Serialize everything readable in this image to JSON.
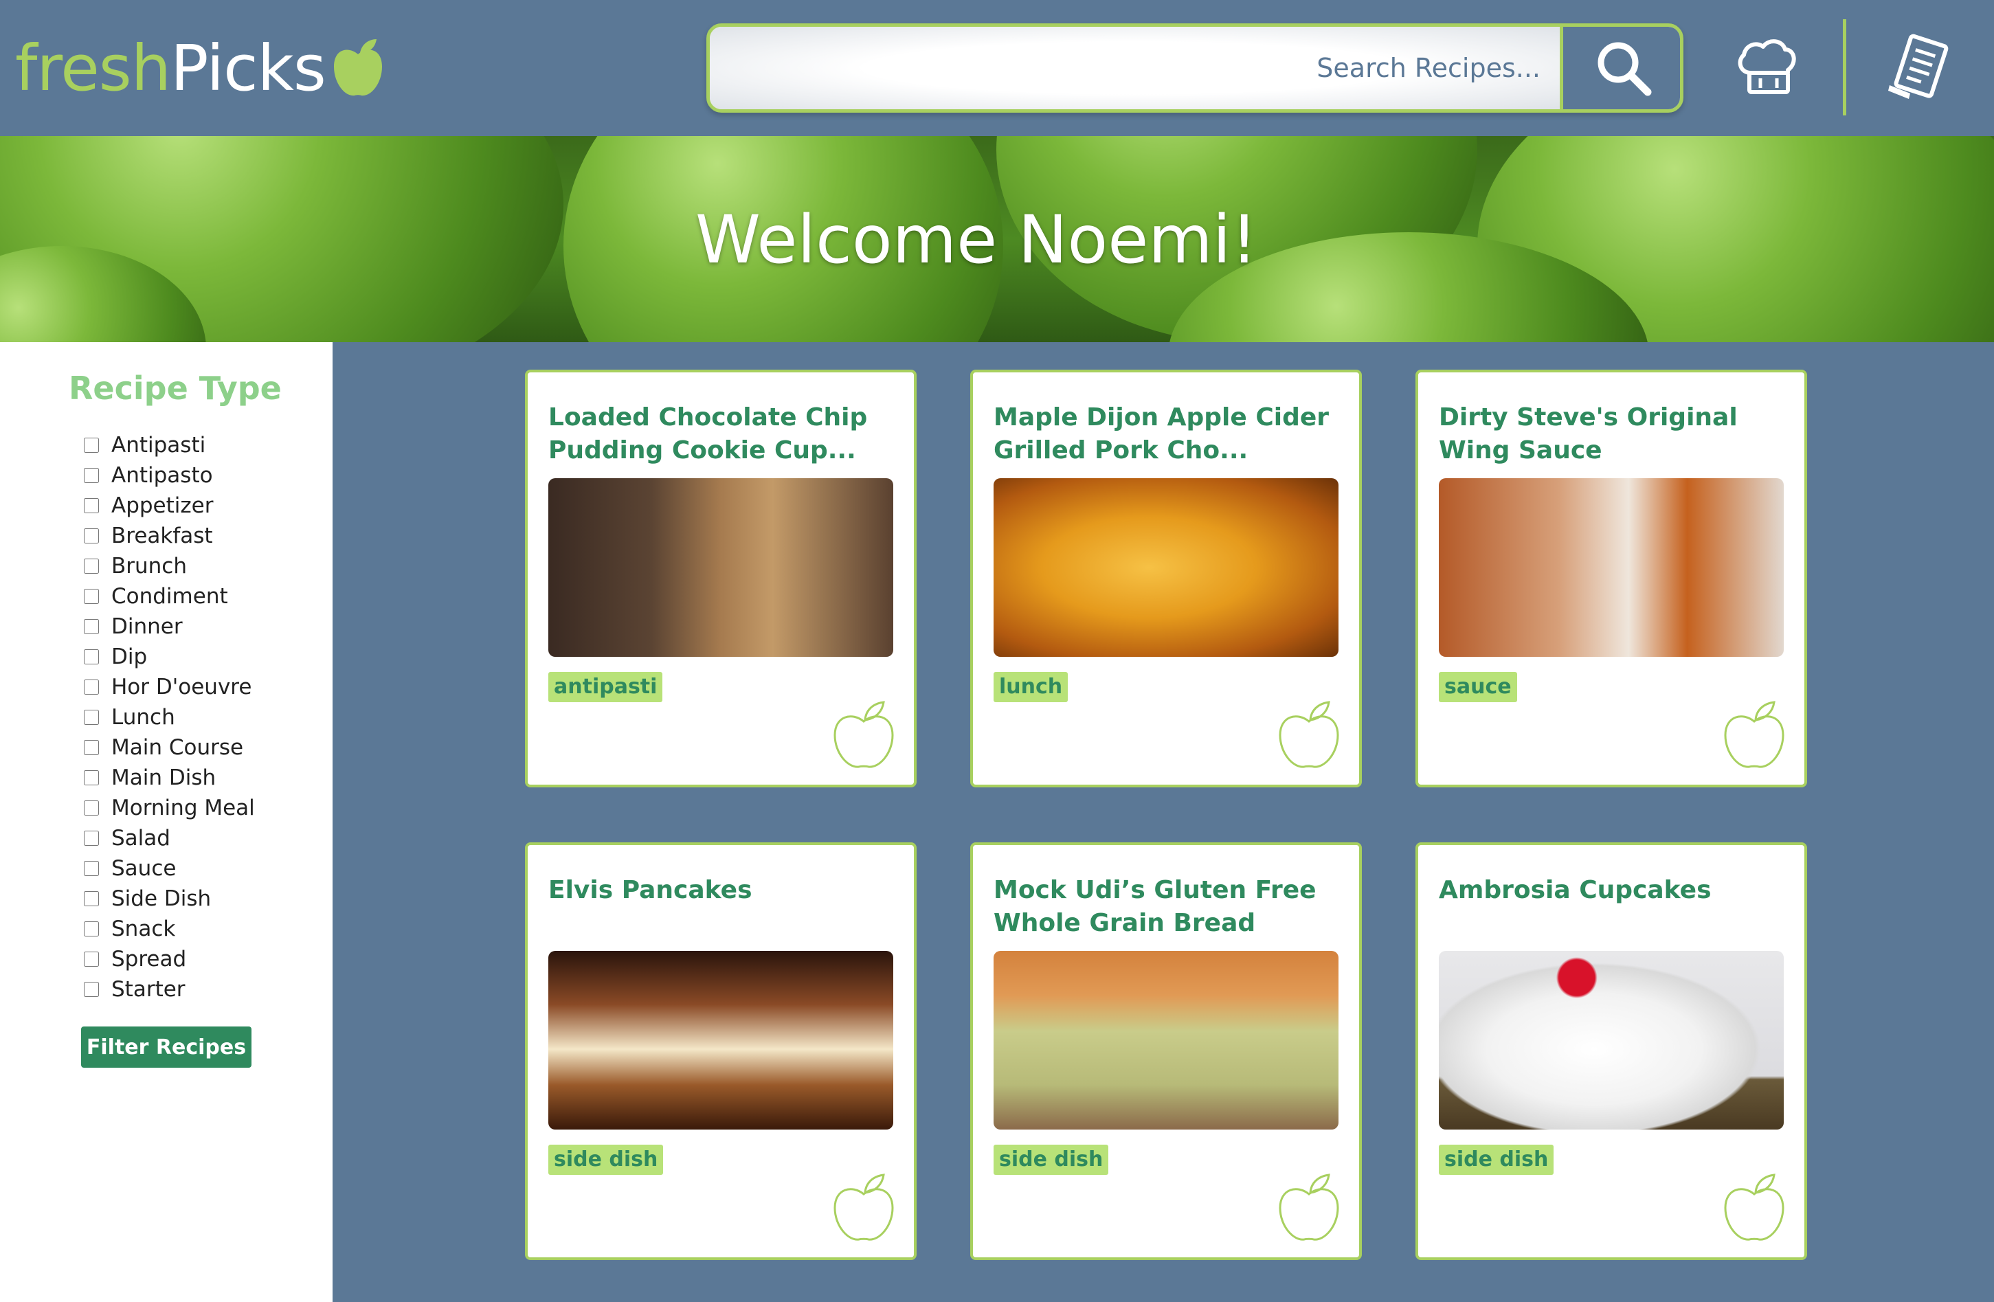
{
  "header": {
    "logo_fresh": "fresh",
    "logo_picks": "Picks",
    "search_placeholder": "Search Recipes..."
  },
  "hero": {
    "welcome": "Welcome  Noemi!"
  },
  "sidebar": {
    "title": "Recipe Type",
    "filters": [
      "Antipasti",
      "Antipasto",
      "Appetizer",
      "Breakfast",
      "Brunch",
      "Condiment",
      "Dinner",
      "Dip",
      "Hor D'oeuvre",
      "Lunch",
      "Main Course",
      "Main Dish",
      "Morning Meal",
      "Salad",
      "Sauce",
      "Side Dish",
      "Snack",
      "Spread",
      "Starter"
    ],
    "filter_button": "Filter Recipes"
  },
  "cards": [
    {
      "title": "Loaded Chocolate Chip Pudding Cookie Cup...",
      "tag": "antipasti"
    },
    {
      "title": "Maple Dijon Apple Cider Grilled Pork Cho...",
      "tag": "lunch"
    },
    {
      "title": "Dirty Steve's Original Wing Sauce",
      "tag": "sauce"
    },
    {
      "title": "Elvis Pancakes",
      "tag": "side dish"
    },
    {
      "title": "Mock Udi’s Gluten Free Whole Grain Bread",
      "tag": "side dish"
    },
    {
      "title": "Ambrosia Cupcakes",
      "tag": "side dish"
    }
  ],
  "colors": {
    "header_bg": "#5b7896",
    "accent_green": "#a8d05f",
    "title_green": "#2f8a5e",
    "sidebar_title": "#8dd08a",
    "tag_bg": "#b8e278"
  },
  "icons": {
    "logo": "apple-icon",
    "search": "search-icon",
    "chef": "chef-hat-icon",
    "list": "recipe-list-icon",
    "favorite": "apple-outline-icon"
  }
}
